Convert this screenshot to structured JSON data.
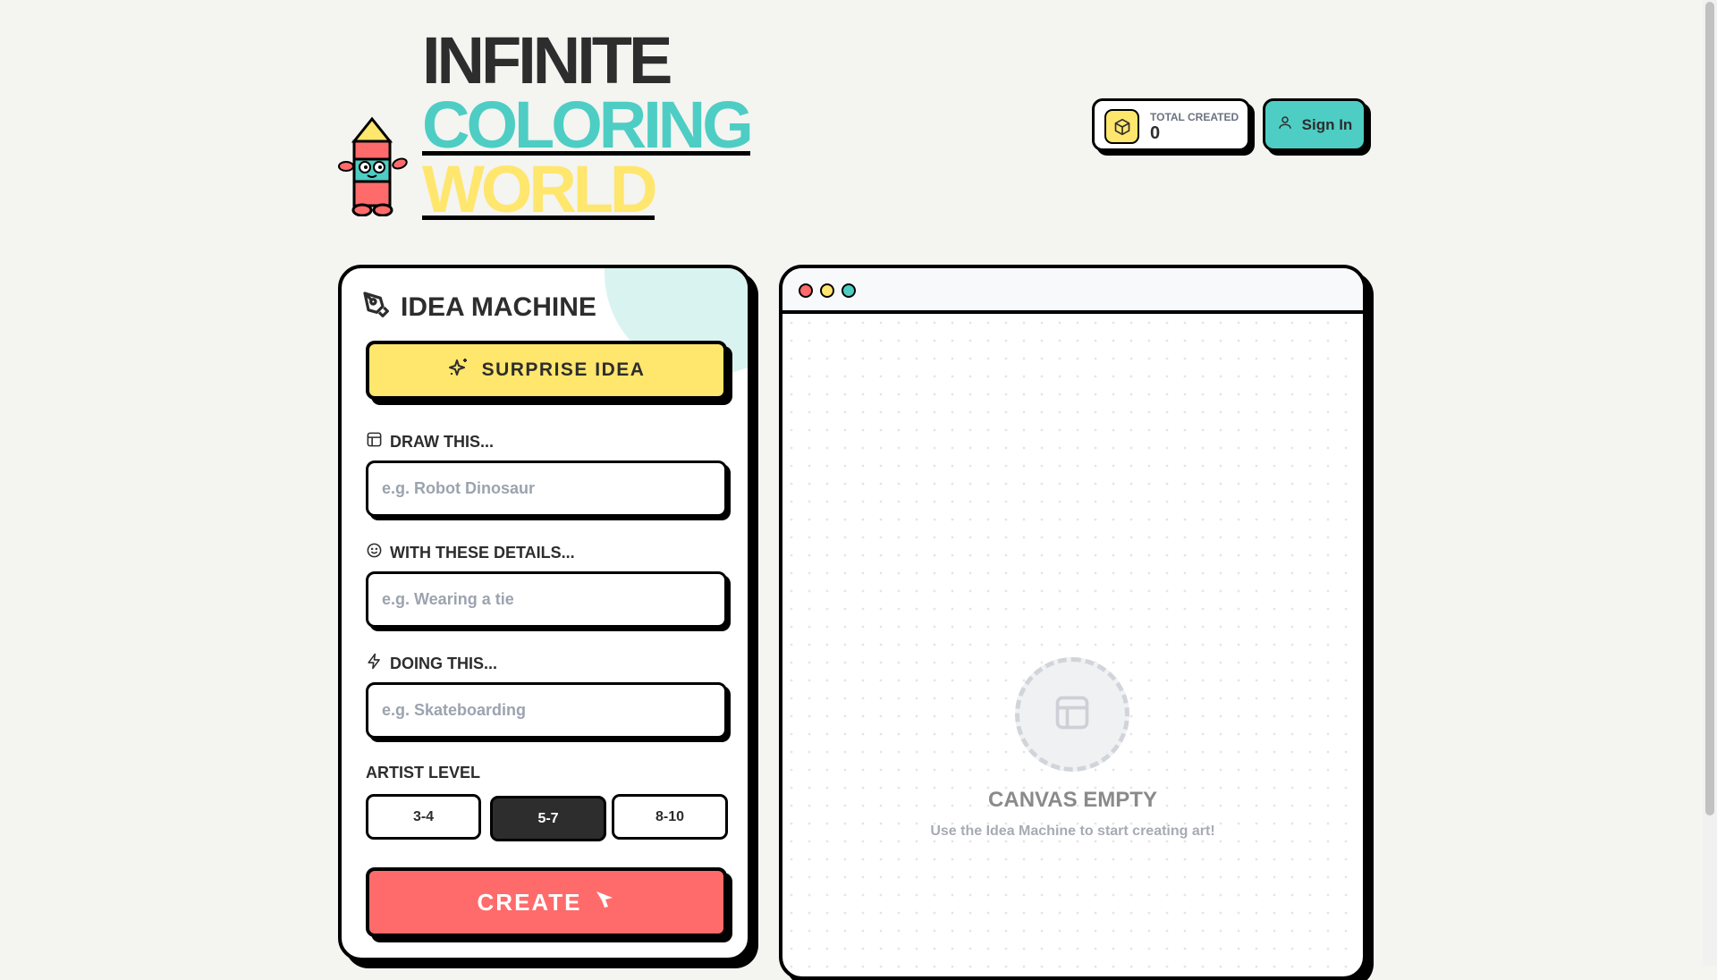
{
  "logo": {
    "line1": "INFINITE",
    "line2": "COLORING",
    "line3": "WORLD",
    "colors": {
      "line1": "#2d2d2d",
      "line2": "#4ecdc4",
      "line3": "#ffe66d"
    }
  },
  "header": {
    "total_created_label": "TOTAL CREATED",
    "total_created_value": "0",
    "sign_in": "Sign In"
  },
  "idea_machine": {
    "title": "IDEA MACHINE",
    "surprise_button": "SURPRISE IDEA",
    "fields": [
      {
        "label": "DRAW THIS...",
        "placeholder": "e.g. Robot Dinosaur",
        "value": ""
      },
      {
        "label": "WITH THESE DETAILS...",
        "placeholder": "e.g. Wearing a tie",
        "value": ""
      },
      {
        "label": "DOING THIS...",
        "placeholder": "e.g. Skateboarding",
        "value": ""
      }
    ],
    "artist_level_label": "ARTIST LEVEL",
    "levels": [
      "3-4",
      "5-7",
      "8-10"
    ],
    "selected_level": "5-7",
    "create_button": "CREATE"
  },
  "canvas": {
    "empty_title": "CANVAS EMPTY",
    "empty_subtitle": "Use the Idea Machine to start creating art!"
  },
  "colors": {
    "bg": "#f4f4f0",
    "yellow": "#ffe66d",
    "teal": "#4ecdc4",
    "red": "#ff6b6b",
    "dark": "#2d2d2d"
  }
}
